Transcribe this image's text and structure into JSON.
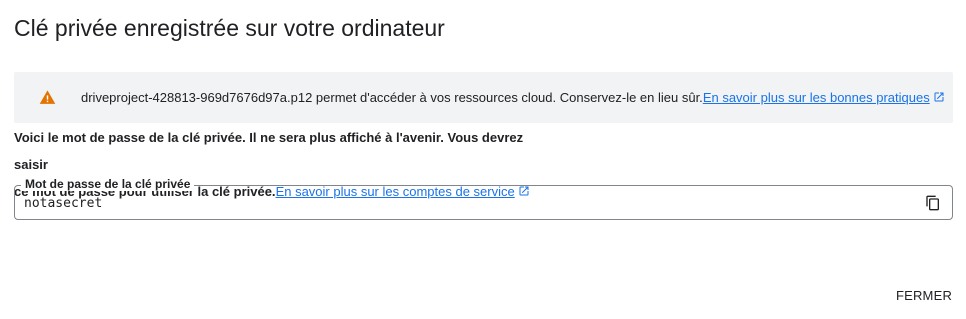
{
  "dialog": {
    "title": "Clé privée enregistrée sur votre ordinateur",
    "banner": {
      "icon": "warning-icon",
      "warning_color": "#e37400",
      "text": "driveproject-428813-969d7676d97a.p12 permet d'accéder à vos ressources cloud. Conservez-le en lieu sûr.",
      "link_label": "En savoir plus sur les bonnes pratiques"
    },
    "info": {
      "line1": "Voici le mot de passe de la clé privée. Il ne sera plus affiché à l'avenir. Vous devrez saisir",
      "line2": "ce mot de passe pour utiliser la clé privée.",
      "link_label": "En savoir plus sur les comptes de service"
    },
    "password_field": {
      "label": "Mot de passe de la clé privée",
      "value": "notasecret",
      "copy_icon": "copy-icon"
    },
    "close_label": "FERMER",
    "link_color": "#1a73e8"
  }
}
